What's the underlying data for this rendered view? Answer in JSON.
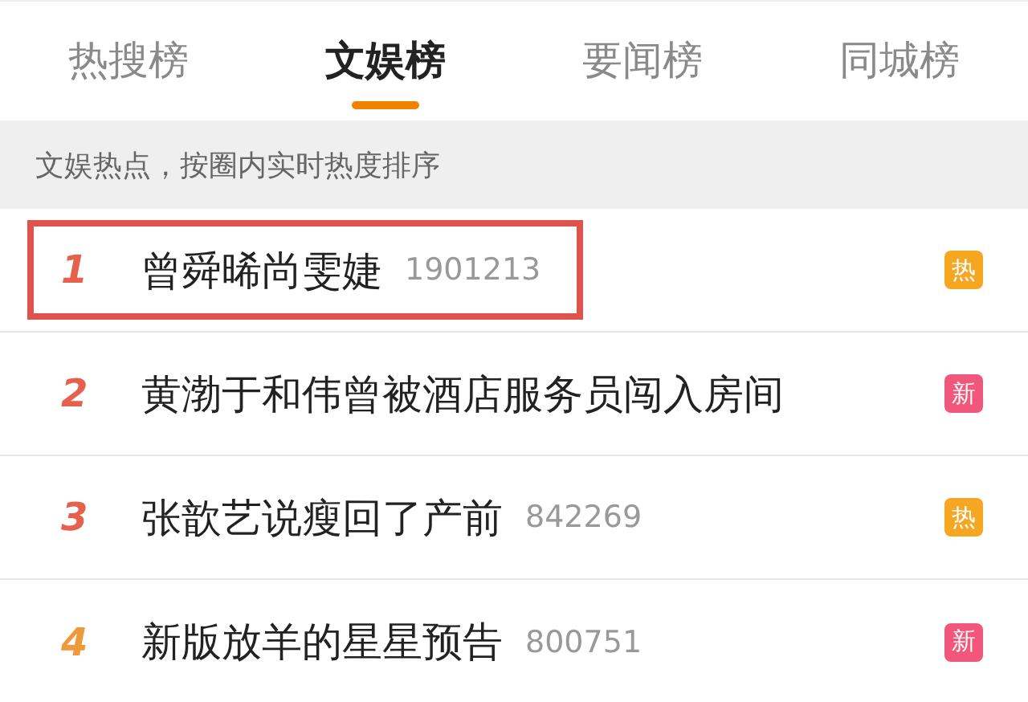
{
  "tabs": [
    {
      "label": "热搜榜",
      "selected": false
    },
    {
      "label": "文娱榜",
      "selected": true
    },
    {
      "label": "要闻榜",
      "selected": false
    },
    {
      "label": "同城榜",
      "selected": false
    }
  ],
  "subtitle": "文娱热点，按圈内实时热度排序",
  "rows": [
    {
      "rank": "1",
      "color": "#e5604d",
      "title": "曾舜晞尚雯婕",
      "count": "1901213",
      "badge": {
        "kind": "hot",
        "label": "热"
      },
      "highlighted": true
    },
    {
      "rank": "2",
      "color": "#e5604d",
      "title": "黄渤于和伟曾被酒店服务员闯入房间",
      "badge": {
        "kind": "new",
        "label": "新"
      },
      "highlighted": false
    },
    {
      "rank": "3",
      "color": "#e5604d",
      "title": "张歆艺说瘦回了产前",
      "count": "842269",
      "badge": {
        "kind": "hot",
        "label": "热"
      },
      "highlighted": false
    },
    {
      "rank": "4",
      "color": "#ee9a3a",
      "title": "新版放羊的星星预告",
      "count": "800751",
      "badge": {
        "kind": "new",
        "label": "新"
      },
      "highlighted": false
    }
  ]
}
